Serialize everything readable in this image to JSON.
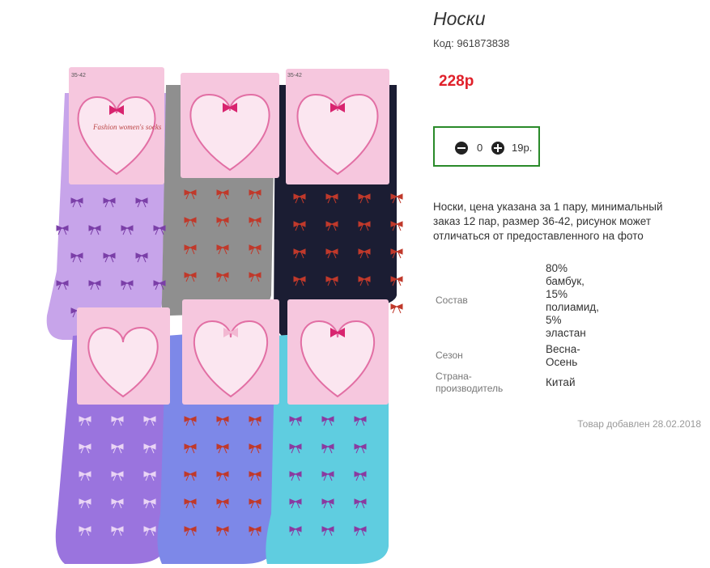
{
  "product": {
    "title": "Носки",
    "code": "Код: 961873838",
    "price": "228р",
    "quantity": {
      "value": "0",
      "unit_price": "19р."
    },
    "description": "Носки, цена указана за 1 пару, минимальный заказ 12 пар, размер 36-42, рисунок может отличаться от предоставленного на фото",
    "properties": [
      {
        "label": "Состав",
        "value": "80% бамбук, 15% полиамид, 5% эластан"
      },
      {
        "label": "Сезон",
        "value": "Весна-Осень"
      },
      {
        "label": "Страна-производитель",
        "value": "Китай"
      }
    ],
    "added": "Товар добавлен 28.02.2018"
  },
  "photo": {
    "tags": [
      "Fashion women's socks"
    ],
    "sizes": "35-42",
    "colors": {
      "top_row": [
        "#c7a4ea",
        "#8f8f8f",
        "#1b1d33"
      ],
      "bottom_row": [
        "#9a74de",
        "#7d88e8",
        "#5fcde0"
      ],
      "label": "#f6c7de",
      "heart": "#fbe6f0",
      "accent": "#e0202a",
      "qty_border": "#2a8a2a"
    }
  }
}
